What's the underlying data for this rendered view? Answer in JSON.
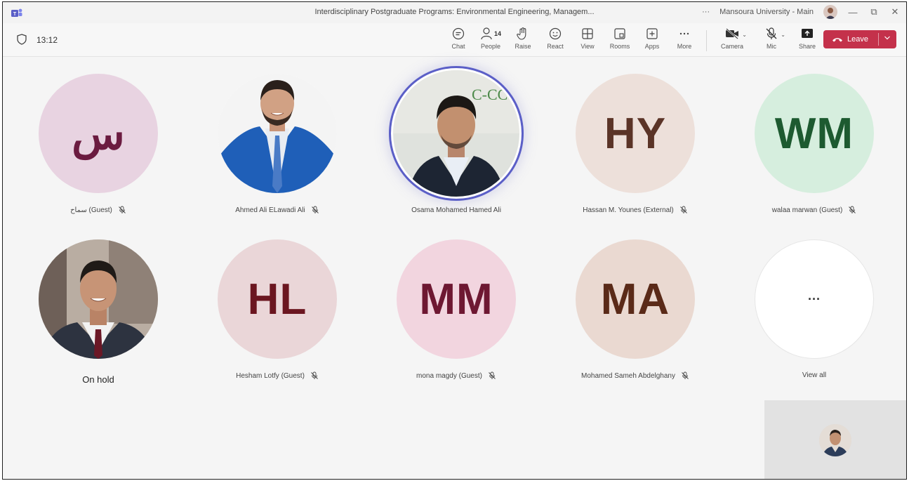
{
  "window": {
    "title": "Interdisciplinary Postgraduate Programs: Environmental Engineering, Managem...",
    "more": "···",
    "account": "Mansoura University - Main",
    "minimize": "—",
    "restore": "⧉",
    "close": "✕"
  },
  "meeting": {
    "timer": "13:12",
    "people_count": "14",
    "controls": {
      "chat": "Chat",
      "people": "People",
      "raise": "Raise",
      "react": "React",
      "view": "View",
      "rooms": "Rooms",
      "apps": "Apps",
      "more": "More",
      "camera": "Camera",
      "mic": "Mic",
      "share": "Share",
      "leave": "Leave"
    }
  },
  "participants": [
    {
      "name": "سماح (Guest)",
      "initials": "س",
      "bg": "#e8d3e1",
      "fg": "#6b1b40",
      "muted": true
    },
    {
      "name": "Ahmed Ali ELawadi Ali",
      "photo": true,
      "muted": true
    },
    {
      "name": "Osama Mohamed Hamed Ali",
      "photo": true,
      "muted": false,
      "speaking": true
    },
    {
      "name": "Hassan M. Younes (External)",
      "initials": "HY",
      "bg": "#ede0da",
      "fg": "#5b3427",
      "muted": true
    },
    {
      "name": "walaa marwan (Guest)",
      "initials": "WM",
      "bg": "#d6eede",
      "fg": "#1d5a30",
      "muted": true
    },
    {
      "name": "On hold",
      "photo": true,
      "muted": false
    },
    {
      "name": "Hesham Lotfy (Guest)",
      "initials": "HL",
      "bg": "#ead6d8",
      "fg": "#6b1620",
      "muted": true
    },
    {
      "name": "mona magdy (Guest)",
      "initials": "MM",
      "bg": "#f2d5df",
      "fg": "#6e1832",
      "muted": true
    },
    {
      "name": "Mohamed Sameh Abdelghany",
      "initials": "MA",
      "bg": "#ead9d1",
      "fg": "#5a2a18",
      "muted": true
    },
    {
      "name": "View all",
      "initials": "···",
      "bg": "#ffffff",
      "fg": "#333333",
      "muted": false
    }
  ]
}
